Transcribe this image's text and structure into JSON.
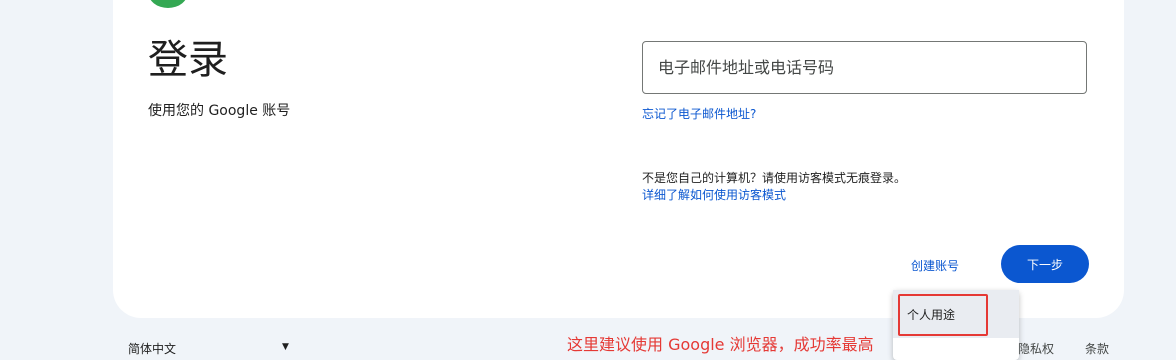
{
  "signin": {
    "title": "登录",
    "subtitle": "使用您的 Google 账号"
  },
  "identifier": {
    "placeholder": "电子邮件地址或电话号码",
    "value": ""
  },
  "links": {
    "forgot_email": "忘记了电子邮件地址?",
    "guest_notice": "不是您自己的计算机？请使用访客模式无痕登录。",
    "learn_guest": "详细了解如何使用访客模式"
  },
  "buttons": {
    "create_account": "创建账号",
    "next": "下一步"
  },
  "create_menu": {
    "items": [
      {
        "label": "个人用途"
      }
    ]
  },
  "footer": {
    "language": "简体中文",
    "privacy": "隐私权",
    "terms": "条款"
  },
  "annotation": {
    "text": "这里建议使用 Google 浏览器，成功率最高",
    "color": "#e53935"
  },
  "colors": {
    "primary": "#0b57d0",
    "background": "#f0f4f9",
    "logo": "#34a853"
  },
  "icons": {
    "logo": "google-logo-icon",
    "dropdown": "dropdown-arrow-icon"
  }
}
